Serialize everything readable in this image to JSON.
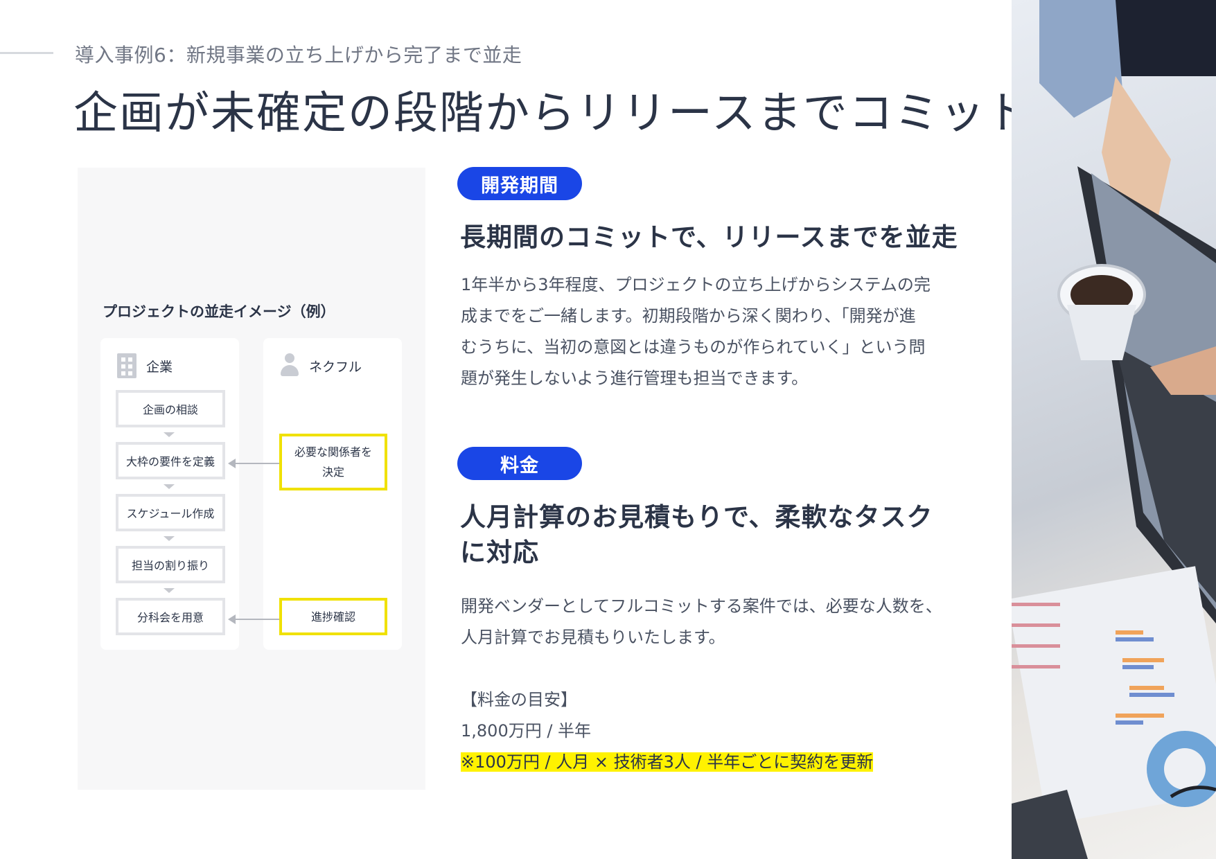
{
  "header": {
    "subtitle": "導入事例6：新規事業の立ち上げから完了まで並走",
    "title": "企画が未確定の段階からリリースまでコミット"
  },
  "diagram": {
    "title": "プロジェクトの並走イメージ（例）",
    "company_label": "企業",
    "nekful_label": "ネクフル",
    "company_steps": [
      "企画の相談",
      "大枠の要件を定義",
      "スケジュール作成",
      "担当の割り振り",
      "分科会を用意"
    ],
    "nekful_steps": [
      "必要な関係者を\n決定",
      "進捗確認"
    ]
  },
  "section1": {
    "badge": "開発期間",
    "heading": "長期間のコミットで、リリースまでを並走",
    "body_lines": [
      "1年半から3年程度、プロジェクトの立ち上げからシステムの完",
      "成までをご一緒します。初期段階から深く関わり、「開発が進",
      "むうちに、当初の意図とは違うものが作られていく」という問",
      "題が発生しないよう進行管理も担当できます。"
    ]
  },
  "section2": {
    "badge": "料金",
    "heading_lines": [
      "人月計算のお見積もりで、柔軟なタスク",
      "に対応"
    ],
    "body_lines": [
      "開発ベンダーとしてフルコミットする案件では、必要な人数を、",
      "人月計算でお見積もりいたします。"
    ],
    "price_title": "【料金の目安】",
    "price": "1,800万円 / 半年",
    "price_note": "※100万円 / 人月 × 技術者3人 / 半年ごとに契約を更新"
  },
  "colors": {
    "accent": "#1a46e6",
    "highlight": "#fff200",
    "text": "#2b3447"
  },
  "photo": {
    "description_icon": "office-desk-photo"
  }
}
